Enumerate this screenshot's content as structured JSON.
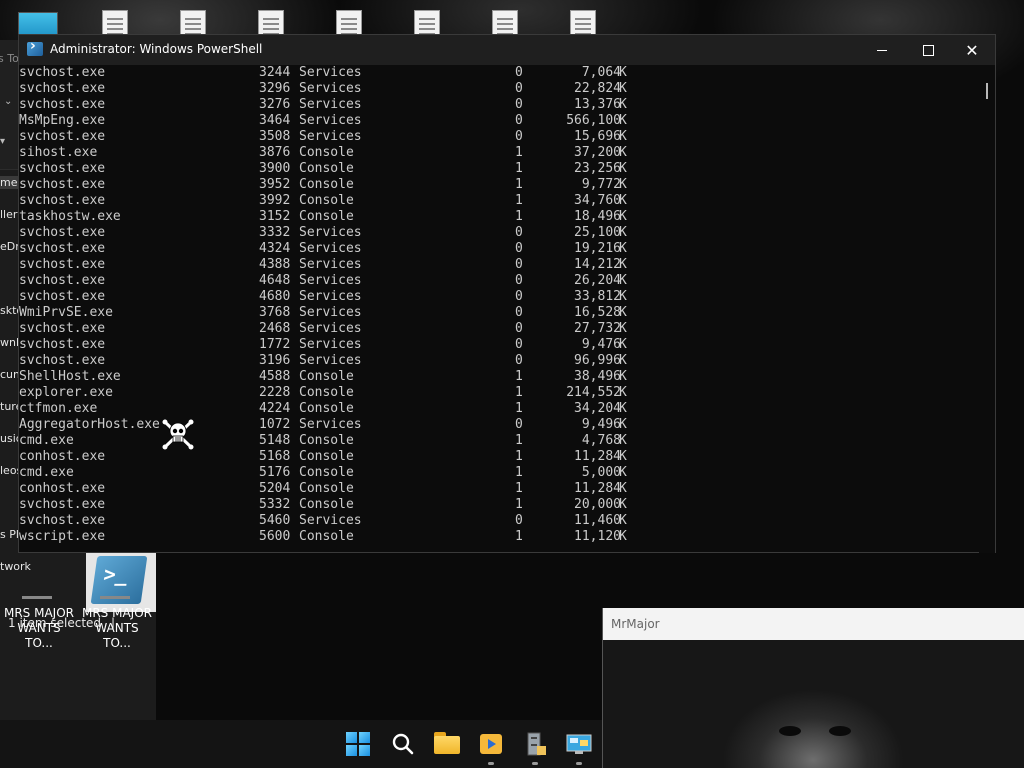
{
  "desktop": {
    "file_labels": [
      "MRS MAJOR WANTS TO...",
      "MRS MAJOR WANTS TO..."
    ]
  },
  "explorer": {
    "nav_fragments": [
      "s To",
      "me",
      "llery",
      "eDr",
      "skto",
      "wnl",
      "cum",
      "ture",
      "usic",
      "leos",
      "s Pl",
      "twork"
    ],
    "status": "1 item selected",
    "status_sep": "|"
  },
  "powershell": {
    "title": "Administrator: Windows PowerShell",
    "processes": [
      {
        "name": "svchost.exe",
        "pid": "3244",
        "session_name": "Services",
        "session_num": "0",
        "mem": "7,064",
        "unit": "K"
      },
      {
        "name": "svchost.exe",
        "pid": "3296",
        "session_name": "Services",
        "session_num": "0",
        "mem": "22,824",
        "unit": "K"
      },
      {
        "name": "svchost.exe",
        "pid": "3276",
        "session_name": "Services",
        "session_num": "0",
        "mem": "13,376",
        "unit": "K"
      },
      {
        "name": "MsMpEng.exe",
        "pid": "3464",
        "session_name": "Services",
        "session_num": "0",
        "mem": "566,100",
        "unit": "K"
      },
      {
        "name": "svchost.exe",
        "pid": "3508",
        "session_name": "Services",
        "session_num": "0",
        "mem": "15,696",
        "unit": "K"
      },
      {
        "name": "sihost.exe",
        "pid": "3876",
        "session_name": "Console",
        "session_num": "1",
        "mem": "37,200",
        "unit": "K"
      },
      {
        "name": "svchost.exe",
        "pid": "3900",
        "session_name": "Console",
        "session_num": "1",
        "mem": "23,256",
        "unit": "K"
      },
      {
        "name": "svchost.exe",
        "pid": "3952",
        "session_name": "Console",
        "session_num": "1",
        "mem": "9,772",
        "unit": "K"
      },
      {
        "name": "svchost.exe",
        "pid": "3992",
        "session_name": "Console",
        "session_num": "1",
        "mem": "34,760",
        "unit": "K"
      },
      {
        "name": "taskhostw.exe",
        "pid": "3152",
        "session_name": "Console",
        "session_num": "1",
        "mem": "18,496",
        "unit": "K"
      },
      {
        "name": "svchost.exe",
        "pid": "3332",
        "session_name": "Services",
        "session_num": "0",
        "mem": "25,100",
        "unit": "K"
      },
      {
        "name": "svchost.exe",
        "pid": "4324",
        "session_name": "Services",
        "session_num": "0",
        "mem": "19,216",
        "unit": "K"
      },
      {
        "name": "svchost.exe",
        "pid": "4388",
        "session_name": "Services",
        "session_num": "0",
        "mem": "14,212",
        "unit": "K"
      },
      {
        "name": "svchost.exe",
        "pid": "4648",
        "session_name": "Services",
        "session_num": "0",
        "mem": "26,204",
        "unit": "K"
      },
      {
        "name": "svchost.exe",
        "pid": "4680",
        "session_name": "Services",
        "session_num": "0",
        "mem": "33,812",
        "unit": "K"
      },
      {
        "name": "WmiPrvSE.exe",
        "pid": "3768",
        "session_name": "Services",
        "session_num": "0",
        "mem": "16,528",
        "unit": "K"
      },
      {
        "name": "svchost.exe",
        "pid": "2468",
        "session_name": "Services",
        "session_num": "0",
        "mem": "27,732",
        "unit": "K"
      },
      {
        "name": "svchost.exe",
        "pid": "1772",
        "session_name": "Services",
        "session_num": "0",
        "mem": "9,476",
        "unit": "K"
      },
      {
        "name": "svchost.exe",
        "pid": "3196",
        "session_name": "Services",
        "session_num": "0",
        "mem": "96,996",
        "unit": "K"
      },
      {
        "name": "ShellHost.exe",
        "pid": "4588",
        "session_name": "Console",
        "session_num": "1",
        "mem": "38,496",
        "unit": "K"
      },
      {
        "name": "explorer.exe",
        "pid": "2228",
        "session_name": "Console",
        "session_num": "1",
        "mem": "214,552",
        "unit": "K"
      },
      {
        "name": "ctfmon.exe",
        "pid": "4224",
        "session_name": "Console",
        "session_num": "1",
        "mem": "34,204",
        "unit": "K"
      },
      {
        "name": "AggregatorHost.exe",
        "pid": "1072",
        "session_name": "Services",
        "session_num": "0",
        "mem": "9,496",
        "unit": "K"
      },
      {
        "name": "cmd.exe",
        "pid": "5148",
        "session_name": "Console",
        "session_num": "1",
        "mem": "4,768",
        "unit": "K"
      },
      {
        "name": "conhost.exe",
        "pid": "5168",
        "session_name": "Console",
        "session_num": "1",
        "mem": "11,284",
        "unit": "K"
      },
      {
        "name": "cmd.exe",
        "pid": "5176",
        "session_name": "Console",
        "session_num": "1",
        "mem": "5,000",
        "unit": "K"
      },
      {
        "name": "conhost.exe",
        "pid": "5204",
        "session_name": "Console",
        "session_num": "1",
        "mem": "11,284",
        "unit": "K"
      },
      {
        "name": "svchost.exe",
        "pid": "5332",
        "session_name": "Console",
        "session_num": "1",
        "mem": "20,000",
        "unit": "K"
      },
      {
        "name": "svchost.exe",
        "pid": "5460",
        "session_name": "Services",
        "session_num": "0",
        "mem": "11,460",
        "unit": "K"
      },
      {
        "name": "wscript.exe",
        "pid": "5600",
        "session_name": "Console",
        "session_num": "1",
        "mem": "11,120",
        "unit": "K"
      }
    ]
  },
  "mrmajor": {
    "title": "MrMajor"
  },
  "taskbar": {
    "icons": [
      "windows-start-icon",
      "search-icon",
      "file-explorer-icon",
      "media-player-icon",
      "file-cabinet-icon",
      "monitor-app-icon"
    ]
  }
}
